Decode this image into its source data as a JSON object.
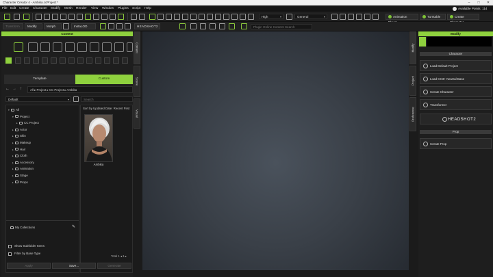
{
  "window": {
    "title": "Character Creator 4 - Ambika.ccProject *",
    "controls": [
      "–",
      "□",
      "✕"
    ]
  },
  "menu": [
    "File",
    "Edit",
    "Create",
    "Character",
    "Modify",
    "Mesh",
    "Render",
    "View",
    "Window",
    "Plugins",
    "Script",
    "Help"
  ],
  "status": {
    "points": "Available Points: 114"
  },
  "toolbar": {
    "quality": "High",
    "shading": "General",
    "animation_player": "Animation Player",
    "turntable": "Turntable",
    "create_character": "Create Character"
  },
  "toolbar2": {
    "transform": "Transform",
    "modify": "Modify",
    "morph": "Morph",
    "instalod": "InstaLOD",
    "headshot": "HEADSHOT2",
    "search_placeholder": "Plugin Online Content Search"
  },
  "content_panel": {
    "title": "Content",
    "tabs": [
      "Template",
      "Custom"
    ],
    "active_tab": "Custom",
    "breadcrumb": [
      "All",
      "Project",
      "CC Project",
      "Ambika"
    ],
    "filter_value": "Default",
    "search_placeholder": "Search",
    "sort_label": "Sort by Updated Date: Recent First",
    "tree": [
      {
        "label": "All",
        "level": 0,
        "expand": "▾"
      },
      {
        "label": "Project",
        "level": 1,
        "expand": "▾"
      },
      {
        "label": "CC Project",
        "level": 2,
        "expand": "▸"
      },
      {
        "label": "Actor",
        "level": 1,
        "expand": "▸"
      },
      {
        "label": "Skin",
        "level": 1,
        "expand": "▸"
      },
      {
        "label": "Makeup",
        "level": 1,
        "expand": "▸"
      },
      {
        "label": "Hair",
        "level": 1,
        "expand": "▸"
      },
      {
        "label": "Cloth",
        "level": 1,
        "expand": "▸"
      },
      {
        "label": "Accessory",
        "level": 1,
        "expand": "▸"
      },
      {
        "label": "Animation",
        "level": 1,
        "expand": "▸"
      },
      {
        "label": "Stage",
        "level": 1,
        "expand": "▸"
      },
      {
        "label": "Props",
        "level": 1,
        "expand": "▸"
      }
    ],
    "collections_label": "My Collections",
    "item": {
      "name": "Ambika"
    },
    "show_subfolder": "Show Subfolder Items",
    "filter_base_type": "Filter by Base Type",
    "total_label": "Total",
    "total_count": "1",
    "page": "1",
    "buttons": {
      "apply": "Apply",
      "save": "Save...",
      "generate": "Generate"
    }
  },
  "side_tabs": {
    "left": [
      "Content",
      "Scene",
      "Visual"
    ],
    "right": [
      "Modify",
      "Project",
      "Preference"
    ]
  },
  "modify_panel": {
    "title": "Modify",
    "character_section": "Character",
    "character_buttons": [
      "Load Default Project",
      "Load CC3+ Neutral Base",
      "Create Character",
      "Transformer"
    ],
    "headshot_label": "HEADSHOT2",
    "prop_section": "Prop",
    "prop_buttons": [
      "Create Prop"
    ]
  },
  "colors": {
    "accent": "#8fd13e",
    "panel_bg": "#1e1e1e",
    "viewport_center": "#4a525c",
    "viewport_edge": "#23272d"
  }
}
